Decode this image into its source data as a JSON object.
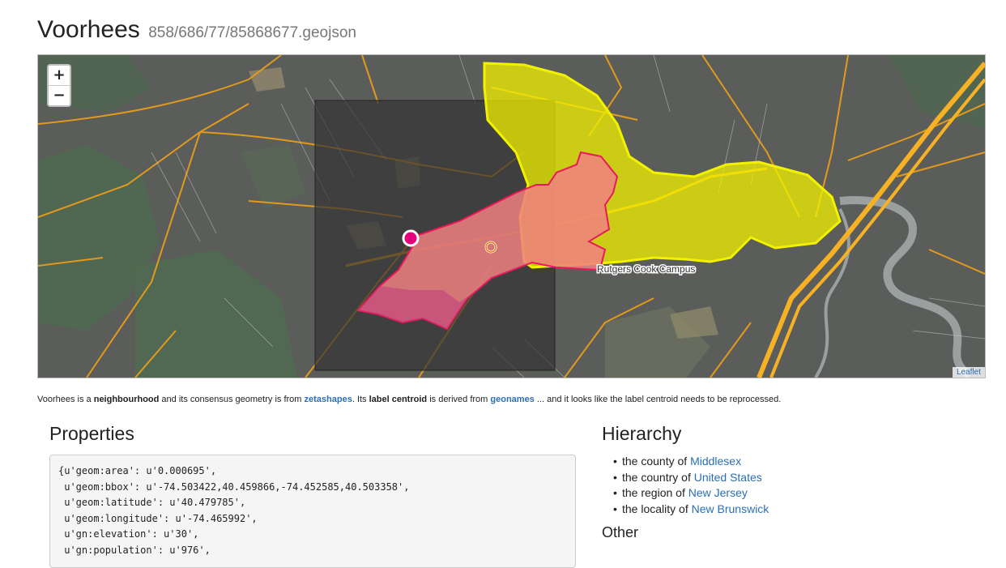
{
  "header": {
    "title": "Voorhees",
    "file": "858/686/77/85868677.geojson"
  },
  "map": {
    "zoom_in": "+",
    "zoom_out": "−",
    "attribution": "Leaflet",
    "place_label": "Rutgers Cook Campus",
    "colors": {
      "base": "#5b5d5a",
      "road": "#f0a21a",
      "highway": "#f7b125",
      "water": "#9aa0a0",
      "bbox_fill": "#333333",
      "parent_fill": "#f2f200",
      "geom_fill": "#f08080",
      "geom_stroke": "#e8195a",
      "label_centroid": "#e3007a",
      "geom_centroid": "#f07d00"
    }
  },
  "description": {
    "name": "Voorhees",
    "t1": " is a ",
    "placetype": "neighbourhood",
    "t2": " and its consensus geometry is from ",
    "geom_source": "zetashapes",
    "t3": ". Its ",
    "label_centroid": "label centroid",
    "t4": " is derived from ",
    "centroid_source": "geonames",
    "t5": " ... and it looks like the label centroid needs to be reprocessed."
  },
  "properties": {
    "heading": "Properties",
    "lines": [
      "{u'geom:area': u'0.000695',",
      " u'geom:bbox': u'-74.503422,40.459866,-74.452585,40.503358',",
      " u'geom:latitude': u'40.479785',",
      " u'geom:longitude': u'-74.465992',",
      " u'gn:elevation': u'30',",
      " u'gn:population': u'976',"
    ]
  },
  "hierarchy": {
    "heading": "Hierarchy",
    "items": [
      {
        "prefix": "the county of ",
        "link": "Middlesex"
      },
      {
        "prefix": "the country of ",
        "link": "United States"
      },
      {
        "prefix": "the region of ",
        "link": "New Jersey"
      },
      {
        "prefix": "the locality of ",
        "link": "New Brunswick"
      }
    ],
    "other_heading": "Other"
  }
}
